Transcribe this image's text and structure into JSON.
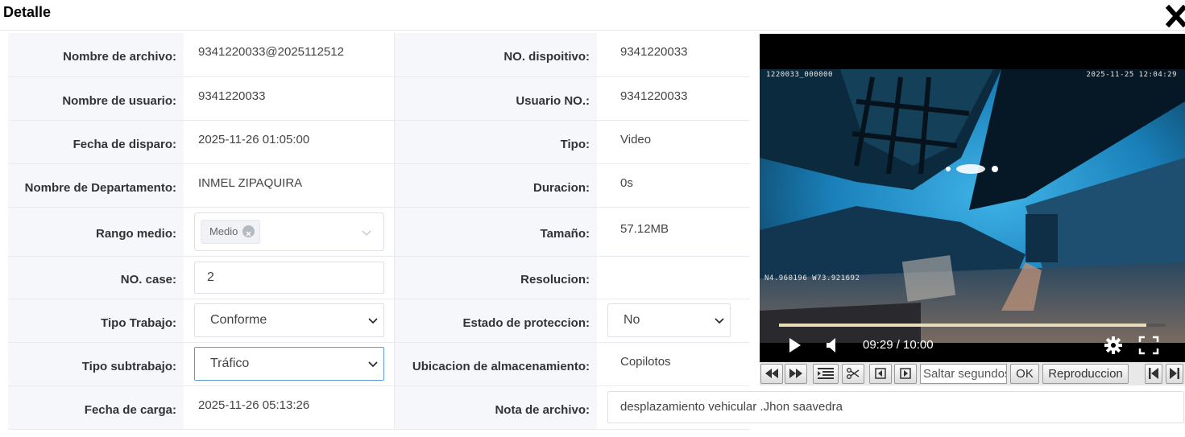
{
  "dialog": {
    "title": "Detalle"
  },
  "form": {
    "file_name": {
      "label": "Nombre de archivo:",
      "value": "9341220033@2025112512"
    },
    "device_no": {
      "label": "NO. dispoitivo:",
      "value": "9341220033"
    },
    "user_name": {
      "label": "Nombre de usuario:",
      "value": "9341220033"
    },
    "user_no": {
      "label": "Usuario NO.:",
      "value": "9341220033"
    },
    "trigger_date": {
      "label": "Fecha de disparo:",
      "value": "2025-11-26 01:05:00"
    },
    "type": {
      "label": "Tipo:",
      "value": "Video"
    },
    "department": {
      "label": "Nombre de Departamento:",
      "value": "INMEL ZIPAQUIRA"
    },
    "duration": {
      "label": "Duracion:",
      "value": "0s"
    },
    "medium_range": {
      "label": "Rango medio:",
      "tag": "Medio"
    },
    "size": {
      "label": "Tamaño:",
      "value": "57.12MB"
    },
    "case_no": {
      "label": "NO. case:",
      "value": "2"
    },
    "resolution": {
      "label": "Resolucion:",
      "value": ""
    },
    "work_type": {
      "label": "Tipo Trabajo:",
      "selected": "Conforme"
    },
    "protection_state": {
      "label": "Estado de proteccion:",
      "selected": "No"
    },
    "work_subtype": {
      "label": "Tipo subtrabajo:",
      "selected": "Tráfico"
    },
    "storage_location": {
      "label": "Ubicacion de almacenamiento:",
      "value": "Copilotos"
    },
    "upload_date": {
      "label": "Fecha de carga:",
      "value": "2025-11-26 05:13:26"
    },
    "file_note": {
      "label": "Nota de archivo:",
      "value": "desplazamiento vehicular .Jhon saavedra"
    }
  },
  "player": {
    "osd_top_left": "1220033_000000",
    "osd_top_right": "2025-11-25 12:04:29",
    "osd_bottom_left": "N4.960196 W73.921692",
    "time_display": "09:29 / 10:00",
    "progress": 0.949
  },
  "toolbar": {
    "jump_placeholder": "Saltar segundos",
    "ok_label": "OK",
    "playback_label": "Reproduccion"
  },
  "colors": {
    "label_bg": "#f5f7fa",
    "border": "#dcdfe6",
    "active_border": "#5b9bd5",
    "video_sky": "#1a8fc4"
  }
}
